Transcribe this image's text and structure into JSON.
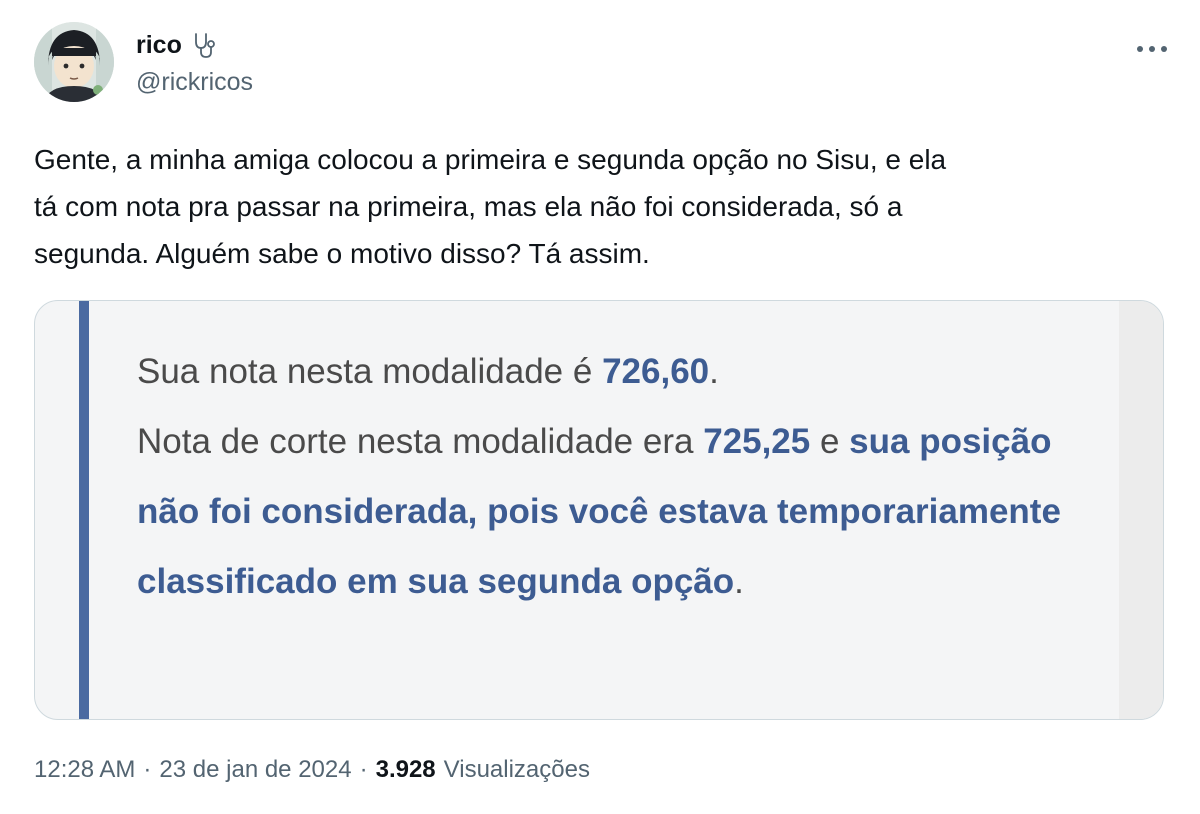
{
  "author": {
    "display_name": "rico",
    "badge_icon": "stethoscope-icon",
    "handle": "@rickricos"
  },
  "menu": {
    "more_icon": "more-horizontal-icon"
  },
  "tweet": {
    "text": "Gente, a minha amiga colocou a primeira e segunda opção no Sisu, e ela\ntá com nota pra passar na primeira, mas ela não foi considerada, só a\nsegunda. Alguém sabe o motivo disso? Tá assim."
  },
  "media": {
    "line1_prefix": "Sua nota nesta modalidade é ",
    "line1_score": "726,60",
    "line1_suffix": ".",
    "line2_prefix": "Nota de corte nesta modalidade era ",
    "line2_cutoff": "725,25",
    "line2_middle": " e ",
    "line2_highlight": "sua posição não foi considerada, pois você estava temporariamente classificado em sua segunda opção",
    "line2_suffix": ".",
    "accent_color": "#4a6aa1",
    "highlight_color": "#3d5c92"
  },
  "meta": {
    "time": "12:28 AM",
    "separator": "·",
    "date": "23 de jan de 2024",
    "views_count": "3.928",
    "views_label": "Visualizações"
  }
}
